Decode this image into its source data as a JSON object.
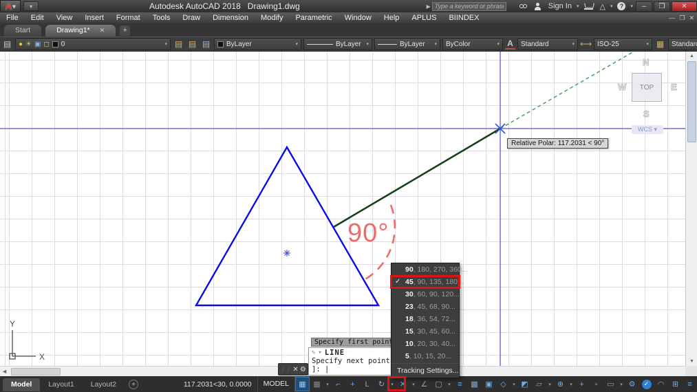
{
  "title_bar": {
    "app_letter": "A",
    "quick_caret": "▾",
    "title": "Autodesk AutoCAD 2018",
    "doc_name": "Drawing1.dwg",
    "search_play": "▶",
    "search_placeholder": "Type a keyword or phrase",
    "sign_in_label": "Sign In",
    "store_icon": "△",
    "help_q": "?",
    "minimize": "–",
    "restore": "❐",
    "close": "✕"
  },
  "menu_bar": {
    "items": [
      "File",
      "Edit",
      "View",
      "Insert",
      "Format",
      "Tools",
      "Draw",
      "Dimension",
      "Modify",
      "Parametric",
      "Window",
      "Help",
      "APLUS",
      "BIINDEX"
    ],
    "minimize": "—",
    "restore": "❐",
    "close": "✕"
  },
  "file_tabs": {
    "start": "Start",
    "drawing": "Drawing1*",
    "close": "✕",
    "add": "+"
  },
  "properties_bar": {
    "layer_tool_icon": "▤",
    "bulb_icon": "●",
    "sun_icon": "☀",
    "monitor_icon": "▣",
    "lock_icon": "◻",
    "layer_current": "0",
    "layer_tools": [
      "▤",
      "▤",
      "▤"
    ],
    "color_value": "ByLayer",
    "linetype_value": "ByLayer",
    "lineweight_value": "ByLayer",
    "plot_style_value": "ByColor",
    "text_style_icon": "A",
    "text_style_value": "Standard",
    "dim_style_icon": "⟷",
    "dim_style_value": "ISO-25",
    "table_style_icon": "▦",
    "table_style_value": "Standard",
    "dd_caret": "▾"
  },
  "viewcube": {
    "north": "N",
    "south": "S",
    "west": "W",
    "east": "E",
    "top": "TOP",
    "wcs": "WCS ▾"
  },
  "drawing": {
    "angle_label": "90°",
    "polar_tooltip": "Relative Polar: 117.2031 < 90°",
    "prompt_tooltip": "Specify first point:",
    "colors": {
      "triangle": "#0a0ae6",
      "tracking_line": "#16411a",
      "tracking_dashed": "#43a24e",
      "construction": "#5b5bd6",
      "annotation_red": "#ef6b6b"
    }
  },
  "ucs": {
    "x_label": "X",
    "y_label": "Y"
  },
  "scrollbars": {
    "up": "▲",
    "down": "▼",
    "left": "◄"
  },
  "command_line": {
    "pen_icon": "✎",
    "caret": "▾",
    "active_command": "LINE",
    "prompt": "Specify next point or [",
    "prompt_end": "]:",
    "cursor": "|"
  },
  "minibar": {
    "grip": "⋮⋮",
    "close": "✕",
    "wrench": "⚙"
  },
  "context_menu": {
    "items": [
      {
        "check": "",
        "bold": "90",
        "rest": ", 180, 270, 360..."
      },
      {
        "check": "✓",
        "bold": "45",
        "rest": ", 90, 135, 180..."
      },
      {
        "check": "",
        "bold": "30",
        "rest": ", 60, 90, 120..."
      },
      {
        "check": "",
        "bold": "23",
        "rest": ", 45, 68, 90..."
      },
      {
        "check": "",
        "bold": "18",
        "rest": ", 36, 54, 72..."
      },
      {
        "check": "",
        "bold": "15",
        "rest": ", 30, 45, 60..."
      },
      {
        "check": "",
        "bold": "10",
        "rest": ", 20, 30, 40..."
      },
      {
        "check": "",
        "bold": "5",
        "rest": ", 10, 15, 20..."
      }
    ],
    "footer": "Tracking Settings..."
  },
  "status_bar": {
    "model_tab": "Model",
    "layout1_tab": "Layout1",
    "layout2_tab": "Layout2",
    "add_tab": "+",
    "coordinates": "117.2031<30, 0.0000",
    "space_label": "MODEL",
    "icons": [
      "▦",
      "▦",
      "▾",
      "⌐",
      "+",
      "L",
      "↻",
      "▾",
      "✕",
      "▾",
      "∠",
      "▢",
      "▾",
      "≡",
      "▩",
      "▣",
      "◇",
      "▾",
      "◩",
      "▱",
      "▾",
      "⊕",
      "▾",
      "+",
      "▫",
      "▭",
      "▾",
      "⚙",
      "✓",
      "◠",
      "⊞",
      "≡"
    ]
  }
}
